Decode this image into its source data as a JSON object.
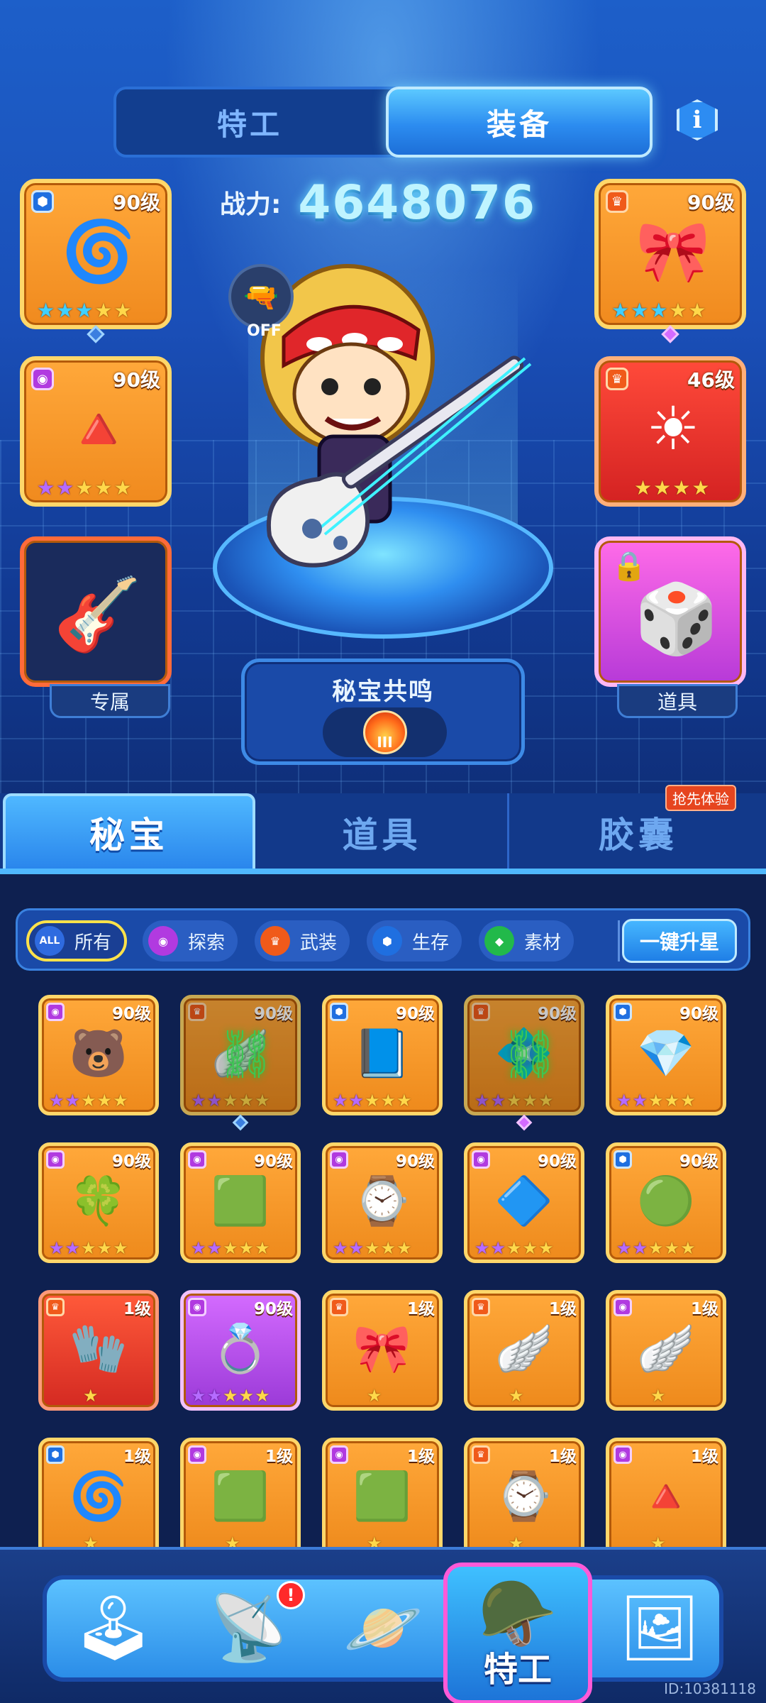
{
  "header": {
    "tab_agent": "特工",
    "tab_equipment": "装备",
    "info_icon": "i"
  },
  "power": {
    "label": "战力:",
    "value": "4648076"
  },
  "skill": {
    "status": "OFF"
  },
  "slots": {
    "left_top": {
      "level": "90级",
      "stars": 5,
      "icon": "fan-disc"
    },
    "left_mid": {
      "level": "90级",
      "stars": 5,
      "icon": "pyramid-orb"
    },
    "left_exclusive": {
      "caption": "专属",
      "icon": "guitar-crystal"
    },
    "right_top": {
      "level": "90级",
      "stars": 5,
      "icon": "bow-ring"
    },
    "right_mid": {
      "level": "46级",
      "stars": 4,
      "icon": "sun-badge"
    },
    "right_item": {
      "caption": "道具",
      "icon": "dice-barrel"
    }
  },
  "resonance": {
    "title": "秘宝共鸣",
    "rank": "III"
  },
  "category_tabs": [
    "秘宝",
    "道具",
    "胶囊"
  ],
  "early_access": "抢先体验",
  "filters": [
    {
      "label": "所有",
      "icon": "ALL",
      "color": "#2f6be0"
    },
    {
      "label": "探索",
      "icon": "◉",
      "color": "#b13ae0"
    },
    {
      "label": "武装",
      "icon": "♛",
      "color": "#f05a1a"
    },
    {
      "label": "生存",
      "icon": "⬢",
      "color": "#1f6fe0"
    },
    {
      "label": "素材",
      "icon": "◆",
      "color": "#22b94a"
    }
  ],
  "upgrade_all": "一键升星",
  "inventory": [
    [
      {
        "level": "90级",
        "theme": "orange",
        "badge": "purple",
        "art": "🐻"
      },
      {
        "level": "90级",
        "theme": "orange",
        "badge": "orange",
        "art": "🪽",
        "locked": true
      },
      {
        "level": "90级",
        "theme": "orange",
        "badge": "blue",
        "art": "📘"
      },
      {
        "level": "90级",
        "theme": "orange",
        "badge": "orange",
        "art": "💠",
        "locked": true
      },
      {
        "level": "90级",
        "theme": "orange",
        "badge": "blue",
        "art": "💎"
      }
    ],
    [
      {
        "level": "90级",
        "theme": "orange",
        "badge": "purple",
        "art": "🍀"
      },
      {
        "level": "90级",
        "theme": "orange",
        "badge": "purple",
        "art": "🟩"
      },
      {
        "level": "90级",
        "theme": "orange",
        "badge": "purple",
        "art": "⌚"
      },
      {
        "level": "90级",
        "theme": "orange",
        "badge": "purple",
        "art": "🔷"
      },
      {
        "level": "90级",
        "theme": "orange",
        "badge": "blue",
        "art": "🟢"
      }
    ],
    [
      {
        "level": "1级",
        "theme": "red",
        "badge": "orange",
        "art": "🧤"
      },
      {
        "level": "90级",
        "theme": "purple",
        "badge": "purple",
        "art": "💍"
      },
      {
        "level": "1级",
        "theme": "orange",
        "badge": "orange",
        "art": "🎀"
      },
      {
        "level": "1级",
        "theme": "orange",
        "badge": "orange",
        "art": "🪽"
      },
      {
        "level": "1级",
        "theme": "orange",
        "badge": "purple",
        "art": "🪽"
      }
    ],
    [
      {
        "level": "1级",
        "theme": "orange",
        "badge": "blue",
        "art": "🌀"
      },
      {
        "level": "1级",
        "theme": "orange",
        "badge": "purple",
        "art": "🟩"
      },
      {
        "level": "1级",
        "theme": "orange",
        "badge": "purple",
        "art": "🟩"
      },
      {
        "level": "1级",
        "theme": "orange",
        "badge": "orange",
        "art": "⌚"
      },
      {
        "level": "1级",
        "theme": "orange",
        "badge": "purple",
        "art": "🔺"
      }
    ]
  ],
  "bottom_nav": {
    "items": [
      "arcade-machine",
      "radar",
      "planet",
      "agent",
      "portal-frame"
    ],
    "active_label": "特工",
    "alert": "!"
  },
  "footer_id": "ID:10381118"
}
